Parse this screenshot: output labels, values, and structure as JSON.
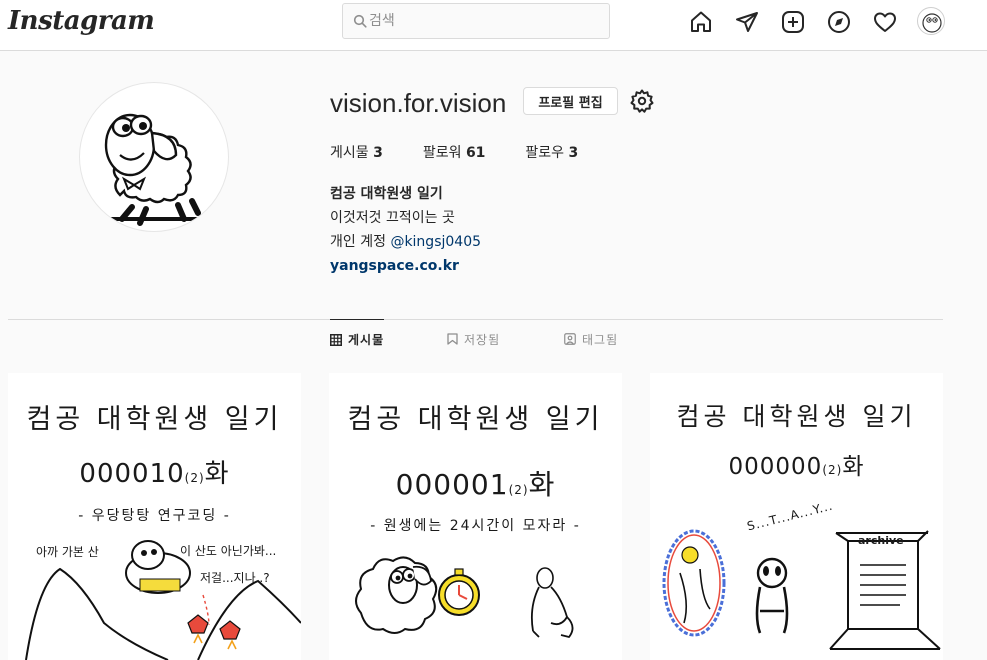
{
  "header": {
    "logo": "Instagram",
    "search_placeholder": "검색",
    "nav_icons": [
      "home-icon",
      "direct-icon",
      "new-post-icon",
      "explore-icon",
      "activity-icon",
      "profile-avatar"
    ]
  },
  "profile": {
    "username": "vision.for.vision",
    "edit_button": "프로필 편집",
    "stats": {
      "posts_label": "게시물",
      "posts_count": "3",
      "followers_label": "팔로워",
      "followers_count": "61",
      "following_label": "팔로우",
      "following_count": "3"
    },
    "bio": {
      "name": "컴공 대학원생 일기",
      "line1": "이것저것 끄적이는 곳",
      "line2_prefix": "개인 계정",
      "mention": "@kingsj0405",
      "website": "yangspace.co.kr"
    }
  },
  "tabs": [
    {
      "label": "게시물",
      "icon": "grid-icon",
      "active": true
    },
    {
      "label": "저장됨",
      "icon": "bookmark-icon",
      "active": false
    },
    {
      "label": "태그됨",
      "icon": "tagged-icon",
      "active": false
    }
  ],
  "posts": [
    {
      "title": "컴공 대학원생 일기",
      "number": "000010",
      "base": "(2)",
      "suffix": "화",
      "subtitle": "- 우당탕탕 연구코딩 -",
      "notes": [
        "아까 가본 산",
        "이 산도 아닌가봐...",
        "저걸...지나..?"
      ]
    },
    {
      "title": "컴공 대학원생 일기",
      "number": "000001",
      "base": "(2)",
      "suffix": "화",
      "subtitle": "- 원생에는 24시간이 모자라 -",
      "notes": []
    },
    {
      "title": "컴공 대학원생 일기",
      "number": "000000",
      "base": "(2)",
      "suffix": "화",
      "subtitle": "",
      "notes": [
        "S...T...A...Y...",
        "archive"
      ]
    }
  ],
  "colors": {
    "accent_link": "#00376b",
    "border": "#dbdbdb",
    "background": "#fafafa",
    "text": "#262626",
    "muted": "#8e8e8e"
  }
}
